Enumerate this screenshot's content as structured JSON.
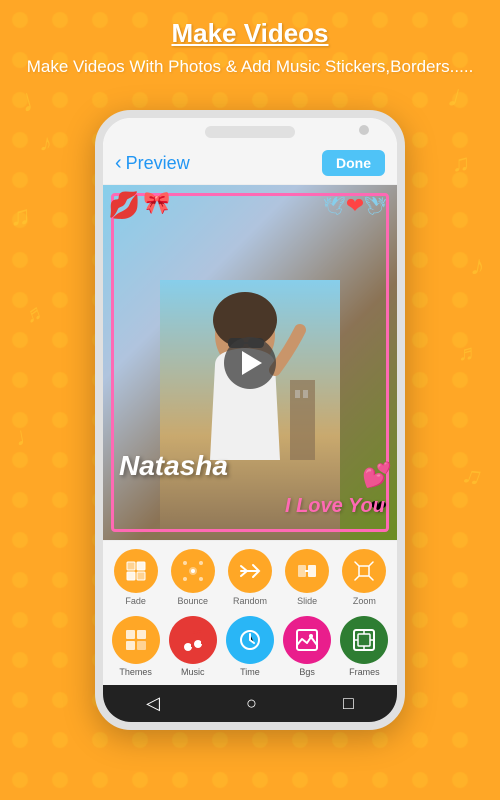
{
  "background_color": "#FFA726",
  "top_section": {
    "title": "Make Videos",
    "subtitle": "Make Videos With Photos & Add Music Stickers,Borders....."
  },
  "phone": {
    "header": {
      "back_label": "Preview",
      "done_label": "Done"
    },
    "video": {
      "name_overlay": "Natasha",
      "love_overlay": "I Love You"
    },
    "transitions": [
      {
        "label": "Fade",
        "icon": "⬜"
      },
      {
        "label": "Bounce",
        "icon": "⠿"
      },
      {
        "label": "Random",
        "icon": "⇄"
      },
      {
        "label": "Slide",
        "icon": "▭"
      },
      {
        "label": "Zoom",
        "icon": "⤢"
      }
    ],
    "tools": [
      {
        "label": "Themes",
        "color": "#FFA726",
        "icon": "🎞"
      },
      {
        "label": "Music",
        "color": "#E53935",
        "icon": "🎵"
      },
      {
        "label": "Time",
        "color": "#29B6F6",
        "icon": "🕐"
      },
      {
        "label": "Bgs",
        "color": "#E91E8C",
        "icon": "🖼"
      },
      {
        "label": "Frames",
        "color": "#2E7D32",
        "icon": "⊞"
      }
    ]
  }
}
